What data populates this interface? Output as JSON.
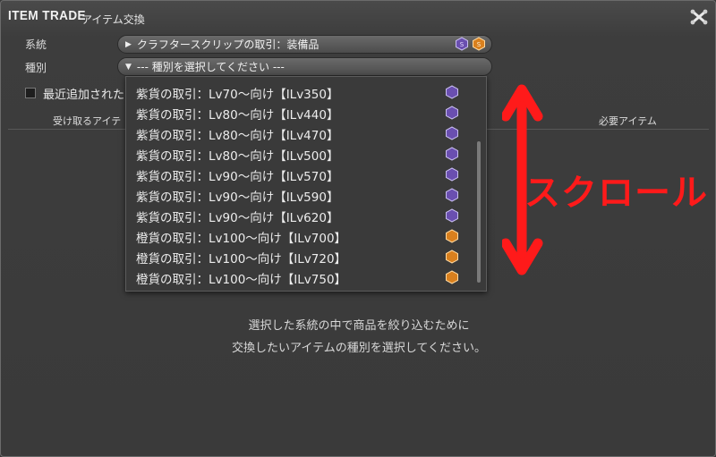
{
  "window": {
    "title_en": "ITEM TRADE",
    "title_jp": "アイテム交換"
  },
  "filters": {
    "system_label": "系統",
    "system_value": "クラフタースクリップの取引：装備品",
    "category_label": "種別",
    "category_value": "--- 種別を選択してください ---"
  },
  "options": {
    "recent_label": "最近追加された"
  },
  "columns": {
    "receive": "受け取るアイテ",
    "required": "必要アイテム"
  },
  "dropdown": {
    "items": [
      {
        "label": "紫貨の取引：Lv70～向け【ILv350】",
        "icon": "purple-scrip-icon"
      },
      {
        "label": "紫貨の取引：Lv80～向け【ILv440】",
        "icon": "purple-scrip-icon"
      },
      {
        "label": "紫貨の取引：Lv80～向け【ILv470】",
        "icon": "purple-scrip-icon"
      },
      {
        "label": "紫貨の取引：Lv80～向け【ILv500】",
        "icon": "purple-scrip-icon"
      },
      {
        "label": "紫貨の取引：Lv90～向け【ILv570】",
        "icon": "purple-scrip-icon"
      },
      {
        "label": "紫貨の取引：Lv90～向け【ILv590】",
        "icon": "purple-scrip-icon"
      },
      {
        "label": "紫貨の取引：Lv90～向け【ILv620】",
        "icon": "purple-scrip-icon"
      },
      {
        "label": "橙貨の取引：Lv100～向け【ILv700】",
        "icon": "orange-scrip-icon"
      },
      {
        "label": "橙貨の取引：Lv100～向け【ILv720】",
        "icon": "orange-scrip-icon"
      },
      {
        "label": "橙貨の取引：Lv100～向け【ILv750】",
        "icon": "orange-scrip-icon"
      }
    ]
  },
  "hint": {
    "line1": "選択した系統の中で商品を絞り込むために",
    "line2": "交換したいアイテムの種別を選択してください。"
  },
  "annotation": {
    "text": "スクロール",
    "color": "#ff1a1a"
  },
  "colors": {
    "purple_scrip": "#6a4fb0",
    "orange_scrip": "#d9801e"
  }
}
